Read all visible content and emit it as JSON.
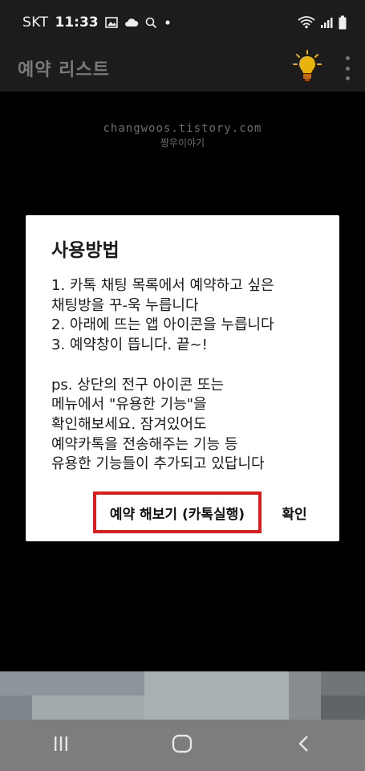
{
  "status_bar": {
    "carrier": "SKT",
    "time": "11:33",
    "icons": [
      "gallery-icon",
      "cloud-icon",
      "search-icon",
      "dot-icon",
      "wifi-icon",
      "signal-icon",
      "battery-icon"
    ]
  },
  "app_bar": {
    "title": "예약 리스트",
    "actions": [
      "lightbulb-icon",
      "overflow-menu-icon"
    ]
  },
  "watermark": {
    "line1": "changwoos.tistory.com",
    "line2": "짱우이야기"
  },
  "dialog": {
    "title": "사용방법",
    "body_lines": [
      "1. 카톡 채팅 목록에서 예약하고 싶은",
      "채팅방을 꾸-욱 누릅니다",
      "2. 아래에 뜨는 앱 아이콘을 누릅니다",
      "3. 예약창이 뜹니다. 끝~!",
      "",
      "ps. 상단의 전구 아이콘 또는",
      "메뉴에서 \"유용한 기능\"을",
      "확인해보세요. 잠겨있어도",
      "예약카톡을 전송해주는 기능 등",
      "유용한 기능들이 추가되고 있답니다"
    ],
    "buttons": {
      "run": "예약 해보기 (카톡실행)",
      "ok": "확인"
    },
    "highlight_color": "#e01b1b"
  },
  "nav_bar": {
    "items": [
      "recent-apps-icon",
      "home-icon",
      "back-icon"
    ]
  }
}
